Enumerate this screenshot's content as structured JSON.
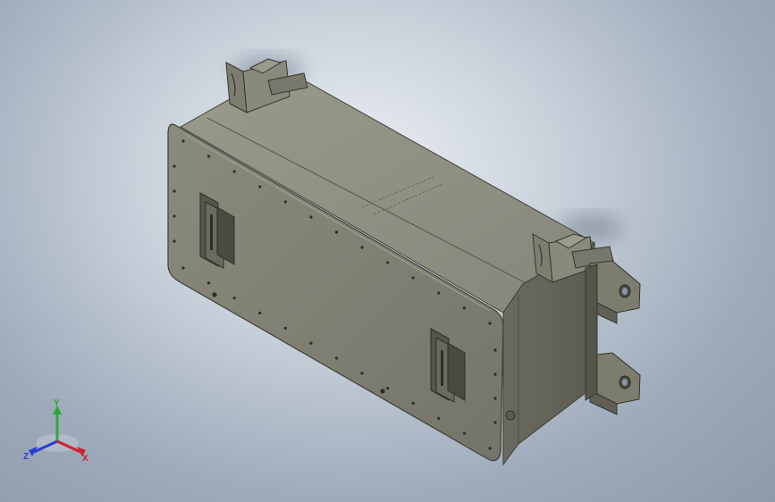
{
  "viewport": {
    "background_top": "#eef1f5",
    "background_bottom": "#8e9aab"
  },
  "model": {
    "description_icon": "battery-box-enclosure",
    "body_color": "#7a7a6c",
    "edge_color": "#3f3f37",
    "bolt_color": "#2e2e28"
  },
  "triad": {
    "x_label": "X",
    "y_label": "Y",
    "z_label": "Z",
    "x_color": "#d0202a",
    "y_color": "#2fa83a",
    "z_color": "#2a3fd6"
  }
}
